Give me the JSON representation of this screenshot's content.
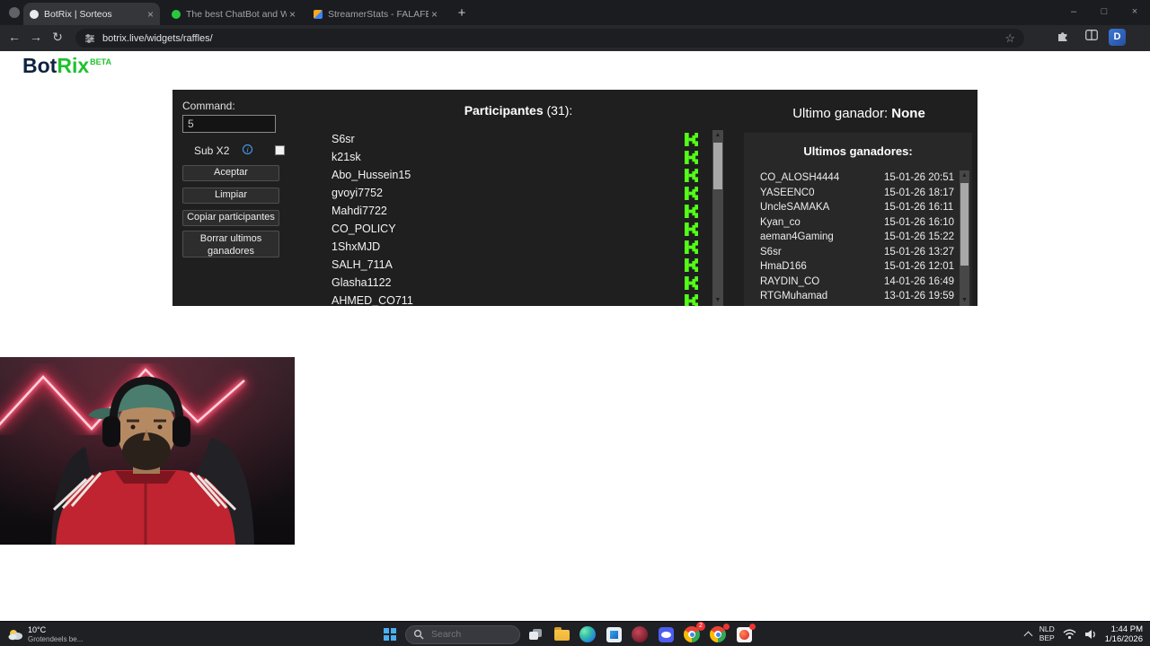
{
  "browser": {
    "tabs": [
      {
        "label": "BotRix | Sorteos"
      },
      {
        "label": "The best ChatBot and Widgets"
      },
      {
        "label": "StreamerStats - FALAFELCO Pr..."
      }
    ],
    "url": "botrix.live/widgets/raffles/",
    "profile_initial": "D"
  },
  "icons": {
    "back": "←",
    "forward": "→",
    "refresh": "↻",
    "star": "☆",
    "close": "×",
    "new_tab": "+",
    "minimize": "–",
    "maximize": "□",
    "window_close": "×",
    "up": "▲",
    "down": "▼",
    "info": "i"
  },
  "logo": {
    "primary": "Bot",
    "accent": "Rix",
    "beta": "BETA"
  },
  "raffle": {
    "command_label": "Command:",
    "command_value": "5",
    "sub_label": "Sub X2",
    "buttons": {
      "accept": "Aceptar",
      "clear": "Limpiar",
      "copy": "Copiar participantes",
      "delete_winners": "Borrar ultimos ganadores"
    },
    "participants": {
      "title": "Participantes",
      "count": "(31):",
      "items": [
        "S6sr",
        "k21sk",
        "Abo_Hussein15",
        "gvoyi7752",
        "Mahdi7722",
        "CO_POLICY",
        "1ShxMJD",
        "SALH_711A",
        "Glasha1122",
        "AHMED_CO711"
      ]
    },
    "winners": {
      "last_label": "Ultimo ganador:",
      "last_value": "None",
      "list_title": "Ultimos ganadores:",
      "items": [
        {
          "name": "CO_ALOSH4444",
          "date": "15-01-26 20:51"
        },
        {
          "name": "YASEENC0",
          "date": "15-01-26 18:17"
        },
        {
          "name": "UncleSAMAKA",
          "date": "15-01-26 16:11"
        },
        {
          "name": "Kyan_co",
          "date": "15-01-26 16:10"
        },
        {
          "name": "aeman4Gaming",
          "date": "15-01-26 15:22"
        },
        {
          "name": "S6sr",
          "date": "15-01-26 13:27"
        },
        {
          "name": "HmaD166",
          "date": "15-01-26 12:01"
        },
        {
          "name": "RAYDIN_CO",
          "date": "14-01-26 16:49"
        },
        {
          "name": "RTGMuhamad",
          "date": "13-01-26 19:59"
        }
      ]
    }
  },
  "taskbar": {
    "weather": {
      "temp": "10°C",
      "desc": "Grotendeels be..."
    },
    "search_placeholder": "Search",
    "badge_count": "2",
    "tray": {
      "lang_line1": "NLD",
      "lang_line2": "BEP",
      "time": "1:44 PM",
      "date": "1/16/2026"
    }
  },
  "colors": {
    "kick_green": "#53FC18",
    "logo_green": "#1FC12F",
    "logo_dark": "#0F2340",
    "panel_bg": "#1F1F1F"
  }
}
